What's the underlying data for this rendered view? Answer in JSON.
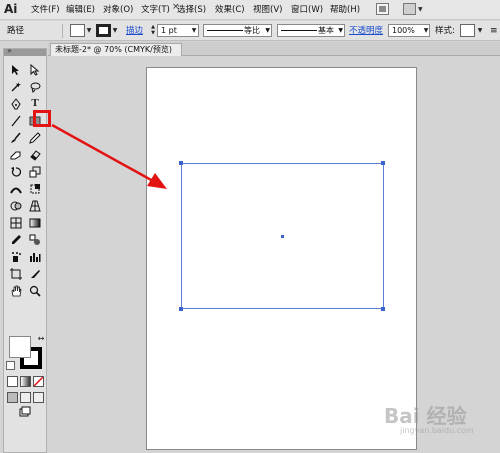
{
  "app": {
    "logo": "Ai"
  },
  "menu": {
    "items": [
      "文件(F)",
      "编辑(E)",
      "对象(O)",
      "文字(T)",
      "选择(S)",
      "效果(C)",
      "视图(V)",
      "窗口(W)",
      "帮助(H)"
    ]
  },
  "control": {
    "path_label": "路径",
    "stroke_label": "描边",
    "stroke_weight": "1 pt",
    "profile_label": "等比",
    "brush_label": "基本",
    "opacity_label": "不透明度",
    "opacity_value": "100%",
    "style_label": "样式:"
  },
  "tab": {
    "title": "未标题-2* @ 70% (CMYK/预览)",
    "close": "×"
  },
  "watermark": {
    "text": "Bai 经验",
    "sub": "jingyan.baidu.com"
  },
  "colors": {
    "highlight": "#e31313",
    "selection": "#3c62d0",
    "artboard": "#ffffff",
    "workspace": "#d4d4d4"
  },
  "tools": [
    "selection-icon",
    "direct-selection-icon",
    "magic-wand-icon",
    "lasso-icon",
    "pen-icon",
    "type-icon",
    "line-segment-icon",
    "rectangle-icon",
    "paintbrush-icon",
    "pencil-icon",
    "blob-brush-icon",
    "eraser-icon",
    "rotate-icon",
    "scale-icon",
    "width-icon",
    "free-transform-icon",
    "shape-builder-icon",
    "perspective-grid-icon",
    "mesh-icon",
    "gradient-icon",
    "eyedropper-icon",
    "blend-icon",
    "symbol-sprayer-icon",
    "column-graph-icon",
    "artboard-icon",
    "slice-icon",
    "hand-icon",
    "zoom-icon"
  ]
}
